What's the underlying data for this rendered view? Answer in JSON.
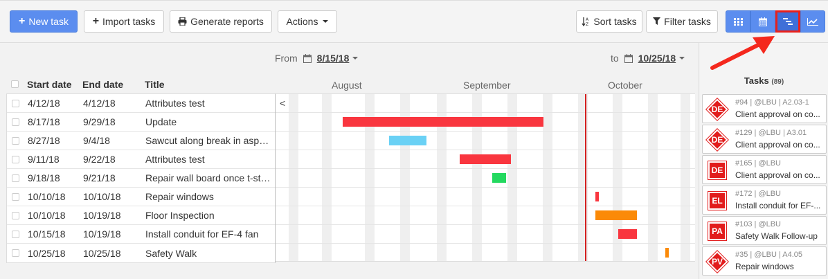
{
  "toolbar": {
    "new_task": "New task",
    "import_tasks": "Import tasks",
    "generate_reports": "Generate reports",
    "actions": "Actions",
    "sort_tasks": "Sort tasks",
    "filter_tasks": "Filter tasks",
    "views": [
      {
        "icon": "grid-icon",
        "active": false
      },
      {
        "icon": "calendar-icon",
        "active": false
      },
      {
        "icon": "gantt-icon",
        "active": true
      },
      {
        "icon": "line-chart-icon",
        "active": false
      }
    ]
  },
  "range": {
    "from_label": "From",
    "from_date": "8/15/18",
    "to_label": "to",
    "to_date": "10/25/18"
  },
  "table": {
    "headers": {
      "start": "Start date",
      "end": "End date",
      "title": "Title"
    },
    "rows": [
      {
        "start": "4/12/18",
        "end": "4/12/18",
        "title": "Attributes test"
      },
      {
        "start": "8/17/18",
        "end": "9/29/18",
        "title": "Update"
      },
      {
        "start": "8/27/18",
        "end": "9/4/18",
        "title": "Sawcut along break in asphalt"
      },
      {
        "start": "9/11/18",
        "end": "9/22/18",
        "title": "Attributes test"
      },
      {
        "start": "9/18/18",
        "end": "9/21/18",
        "title": "Repair wall board once t-stat i..."
      },
      {
        "start": "10/10/18",
        "end": "10/10/18",
        "title": "Repair windows"
      },
      {
        "start": "10/10/18",
        "end": "10/19/18",
        "title": "Floor Inspection"
      },
      {
        "start": "10/15/18",
        "end": "10/19/18",
        "title": "Install conduit for EF-4 fan"
      },
      {
        "start": "10/25/18",
        "end": "10/25/18",
        "title": "Safety Walk"
      }
    ]
  },
  "gantt": {
    "months": [
      "August",
      "September",
      "October"
    ],
    "back_symbol": "<",
    "today_color": "#d42020",
    "bar_colors": [
      "",
      "#f9363f",
      "#6ad1f5",
      "#f9363f",
      "#23d95f",
      "#f9363f",
      "#fb8a08",
      "#f9363f",
      "#fb8a08"
    ]
  },
  "side": {
    "title": "Tasks",
    "count": "(89)",
    "tasks": [
      {
        "badge": "DE",
        "shape": "diamond",
        "meta": "#94 | @LBU | A2.03-1",
        "title": "Client approval on co..."
      },
      {
        "badge": "DE",
        "shape": "diamond",
        "meta": "#129 | @LBU | A3.01",
        "title": "Client approval on co..."
      },
      {
        "badge": "DE",
        "shape": "square",
        "meta": "#165 | @LBU",
        "title": "Client approval on co..."
      },
      {
        "badge": "EL",
        "shape": "square",
        "meta": "#172 | @LBU",
        "title": "Install conduit for EF-..."
      },
      {
        "badge": "PA",
        "shape": "square",
        "meta": "#103 | @LBU",
        "title": "Safety Walk Follow-up"
      },
      {
        "badge": "PV",
        "shape": "diamond",
        "meta": "#35 | @LBU | A4.05",
        "title": "Repair windows"
      }
    ]
  }
}
